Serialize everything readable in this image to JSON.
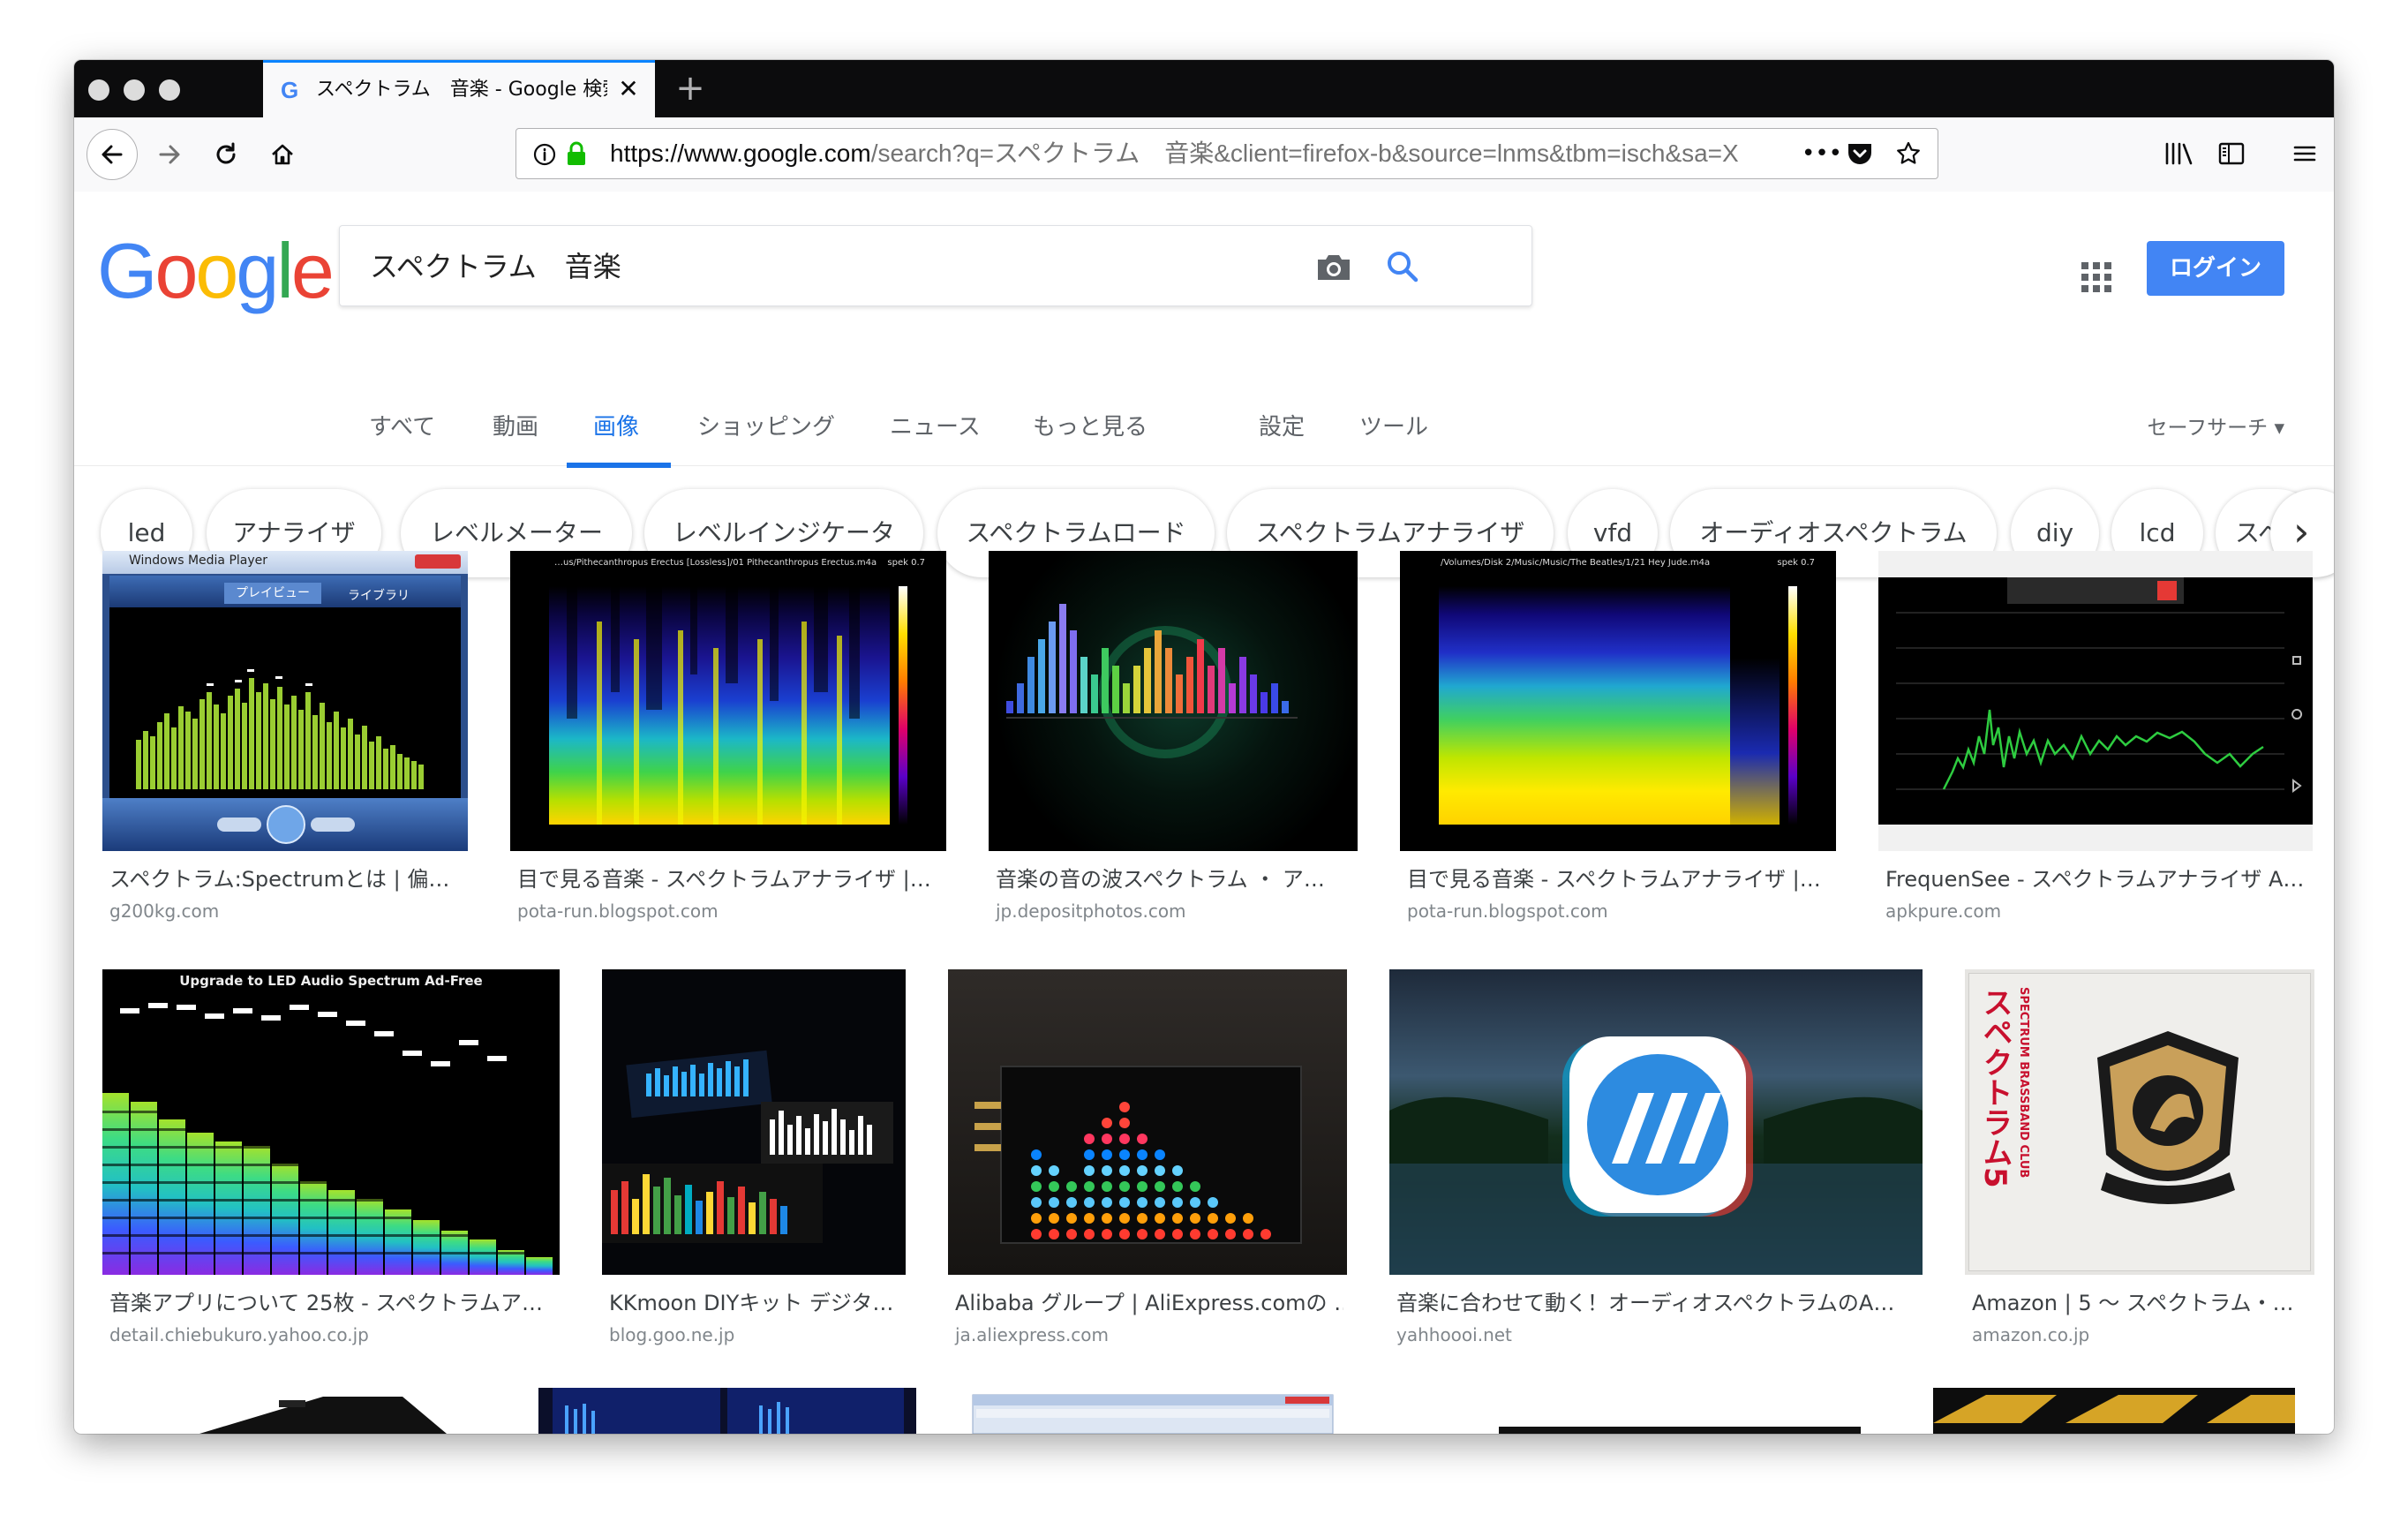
{
  "browser": {
    "tab_title": "スペクトラム　音楽 - Google 検索",
    "url_host": "https://www.google.com",
    "url_rest": "/search?q=スペクトラム　音楽&client=firefox-b&source=lnms&tbm=isch&sa=X",
    "overflow_dots": "•••"
  },
  "google": {
    "logo": [
      "G",
      "o",
      "o",
      "g",
      "l",
      "e"
    ],
    "logo_colors": [
      "#4285f4",
      "#ea4335",
      "#fbbc05",
      "#4285f4",
      "#34a853",
      "#ea4335"
    ],
    "query": "スペクトラム　音楽",
    "login_label": "ログイン",
    "tabs": [
      "すべて",
      "動画",
      "画像",
      "ショッピング",
      "ニュース",
      "もっと見る",
      "設定",
      "ツール"
    ],
    "active_tab": "画像",
    "safesearch": "セーフサーチ ▾"
  },
  "chips": [
    "led",
    "アナライザ",
    "レベルメーター",
    "レベルインジケータ",
    "スペクトラムロード",
    "スペクトラムアナライザ",
    "vfd",
    "オーディオスペクトラム",
    "diy",
    "lcd",
    "スペ"
  ],
  "results": [
    {
      "title": "スペクトラム:Spectrumとは | 偏…",
      "site": "g200kg.com",
      "thumb_text": "Windows Media Player",
      "thumb_text2": "プレイビュー",
      "thumb_text3": "ライブラリ"
    },
    {
      "title": "目で見る音楽 - スペクトラムアナライザ |…",
      "site": "pota-run.blogspot.com",
      "thumb_text": "…us/Pithecanthropus Erectus [Lossless]/01 Pithecanthropus Erectus.m4a",
      "thumb_text2": "spek 0.7"
    },
    {
      "title": "音楽の音の波スペクトラム ・ ア…",
      "site": "jp.depositphotos.com"
    },
    {
      "title": "目で見る音楽 - スペクトラムアナライザ |…",
      "site": "pota-run.blogspot.com",
      "thumb_text": "/Volumes/Disk 2/Music/Music/The Beatles/1/21 Hey Jude.m4a",
      "thumb_text2": "spek 0.7"
    },
    {
      "title": "FrequenSee - スペクトラムアナライザ A…",
      "site": "apkpure.com"
    },
    {
      "title": "音楽アプリについて 25枚 - スペクトラムア…",
      "site": "detail.chiebukuro.yahoo.co.jp",
      "thumb_text": "Upgrade to LED Audio Spectrum Ad-Free"
    },
    {
      "title": "KKmoon DIYキット デジタ…",
      "site": "blog.goo.ne.jp"
    },
    {
      "title": "Alibaba グループ | AliExpress.comの …",
      "site": "ja.aliexpress.com"
    },
    {
      "title": "音楽に合わせて動く！オーディオスペクトラムのA…",
      "site": "yahhoooi.net"
    },
    {
      "title": "Amazon | 5 〜 スペクトラム・…",
      "site": "amazon.co.jp",
      "thumb_text": "スペクトラム5",
      "thumb_text2": "SPECTRUM BRASSBAND CLUB"
    }
  ]
}
